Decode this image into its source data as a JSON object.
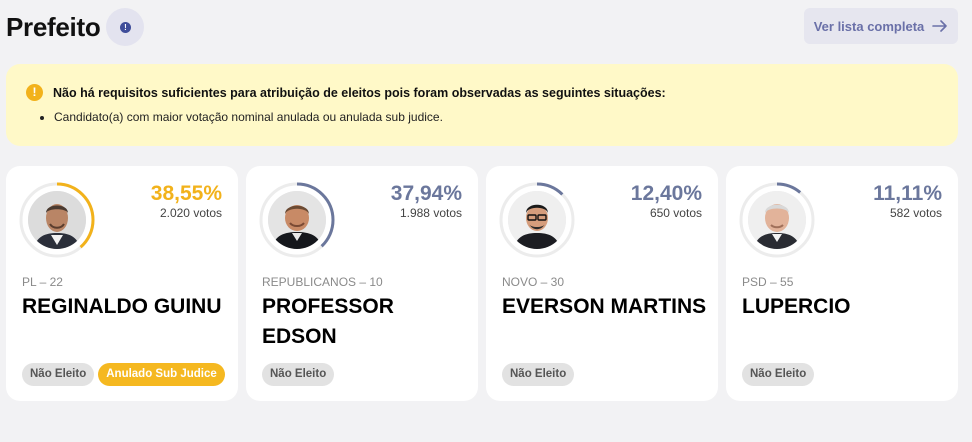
{
  "page": {
    "title": "Prefeito",
    "list_button": "Ver lista completa"
  },
  "alert": {
    "title": "Não há requisitos suficientes para atribuição de eleitos pois foram observadas as seguintes situações:",
    "items": [
      "Candidato(a) com maior votação nominal anulada ou anulada sub judice."
    ]
  },
  "colors": {
    "leader": "#f2b21b",
    "other": "#6b779c",
    "ring_track": "#ececec"
  },
  "candidates": [
    {
      "percent_text": "38,55%",
      "percent": 38.55,
      "votes": "2.020 votos",
      "party": "PL – 22",
      "name": "REGINALDO GUINU",
      "badges": [
        "Não Eleito",
        "Anulado Sub Judice"
      ]
    },
    {
      "percent_text": "37,94%",
      "percent": 37.94,
      "votes": "1.988 votos",
      "party": "REPUBLICANOS – 10",
      "name": "PROFESSOR EDSON",
      "badges": [
        "Não Eleito"
      ]
    },
    {
      "percent_text": "12,40%",
      "percent": 12.4,
      "votes": "650 votos",
      "party": "NOVO – 30",
      "name": "EVERSON MARTINS",
      "badges": [
        "Não Eleito"
      ]
    },
    {
      "percent_text": "11,11%",
      "percent": 11.11,
      "votes": "582 votos",
      "party": "PSD – 55",
      "name": "LUPERCIO",
      "badges": [
        "Não Eleito"
      ]
    }
  ]
}
